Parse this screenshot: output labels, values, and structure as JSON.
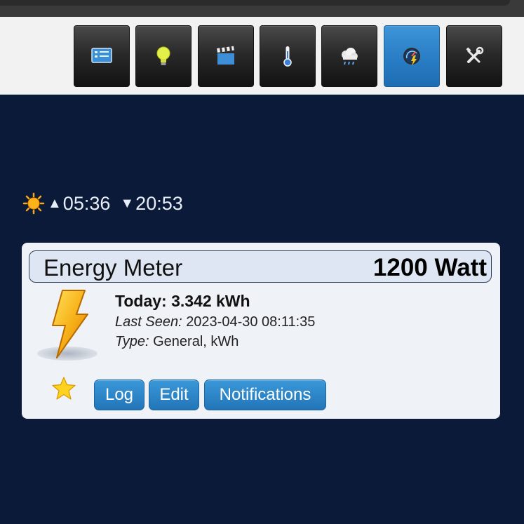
{
  "toolbar": {
    "buttons": [
      {
        "name": "dashboard",
        "icon": "dashboard-icon",
        "active": false
      },
      {
        "name": "lights",
        "icon": "lightbulb-icon",
        "active": false
      },
      {
        "name": "scenes",
        "icon": "clapperboard-icon",
        "active": false
      },
      {
        "name": "temperature",
        "icon": "thermometer-icon",
        "active": false
      },
      {
        "name": "weather",
        "icon": "rain-cloud-icon",
        "active": false
      },
      {
        "name": "utility",
        "icon": "meter-icon",
        "active": true
      },
      {
        "name": "setup",
        "icon": "tools-icon",
        "active": false
      }
    ],
    "active_color": "#2a7fc6"
  },
  "sun": {
    "icon": "sun-icon",
    "sunrise_symbol": "▲",
    "sunrise": "05:36",
    "sunset_symbol": "▼",
    "sunset": "20:53"
  },
  "device": {
    "name": "Energy Meter",
    "value": "1200 Watt",
    "icon": "lightning-bolt-icon",
    "today": "Today: 3.342 kWh",
    "last_seen_label": "Last Seen:",
    "last_seen": "2023-04-30 08:11:35",
    "type_label": "Type:",
    "type": "General, kWh",
    "favorite_icon": "star-icon",
    "buttons": {
      "log": "Log",
      "edit": "Edit",
      "notifications": "Notifications"
    }
  },
  "colors": {
    "background": "#0b1a38",
    "card": "#eff3f8",
    "button": "#2a7fc6"
  }
}
